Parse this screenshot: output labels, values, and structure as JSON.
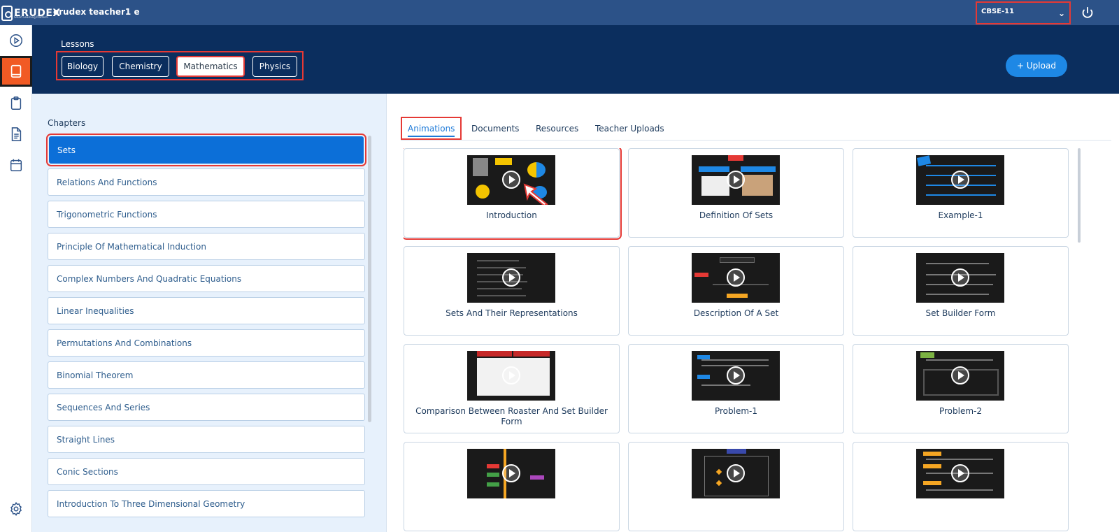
{
  "app": {
    "logo_text": "ERUDEX",
    "logo_subtext": "Smart Learning Platform",
    "user_name": "erudex teacher1 e",
    "class_selector": {
      "selected": "CBSE-11"
    }
  },
  "sidebar": {
    "items": [
      {
        "name": "play-circle-icon"
      },
      {
        "name": "book-icon",
        "active": true
      },
      {
        "name": "clipboard-icon"
      },
      {
        "name": "document-icon"
      },
      {
        "name": "calendar-icon"
      }
    ],
    "settings": {
      "name": "gear-icon"
    }
  },
  "lessons": {
    "label": "Lessons",
    "subjects": [
      {
        "label": "Biology"
      },
      {
        "label": "Chemistry"
      },
      {
        "label": "Mathematics",
        "active": true
      },
      {
        "label": "Physics"
      }
    ],
    "upload_label": "+ Upload"
  },
  "chapters": {
    "title": "Chapters",
    "items": [
      {
        "label": "Sets",
        "active": true
      },
      {
        "label": "Relations And Functions"
      },
      {
        "label": "Trigonometric Functions"
      },
      {
        "label": "Principle Of Mathematical Induction"
      },
      {
        "label": "Complex Numbers And Quadratic Equations"
      },
      {
        "label": "Linear Inequalities"
      },
      {
        "label": "Permutations And Combinations"
      },
      {
        "label": "Binomial Theorem"
      },
      {
        "label": "Sequences And Series"
      },
      {
        "label": "Straight Lines"
      },
      {
        "label": "Conic Sections"
      },
      {
        "label": "Introduction To Three Dimensional Geometry"
      }
    ]
  },
  "content": {
    "tabs": [
      {
        "label": "Animations",
        "active": true
      },
      {
        "label": "Documents"
      },
      {
        "label": "Resources"
      },
      {
        "label": "Teacher Uploads"
      }
    ],
    "cards": [
      {
        "title": "Introduction"
      },
      {
        "title": "Definition Of Sets"
      },
      {
        "title": "Example-1"
      },
      {
        "title": "Sets And Their Representations"
      },
      {
        "title": "Description Of A Set"
      },
      {
        "title": "Set Builder Form"
      },
      {
        "title": "Comparison Between Roaster And Set Builder Form"
      },
      {
        "title": "Problem-1"
      },
      {
        "title": "Problem-2"
      },
      {
        "title": ""
      },
      {
        "title": ""
      },
      {
        "title": ""
      }
    ]
  },
  "colors": {
    "topbar": "#2c5288",
    "header": "#0b2e5e",
    "accent": "#0c6fd8",
    "active_nav": "#f15a24",
    "highlight": "#e53935"
  }
}
